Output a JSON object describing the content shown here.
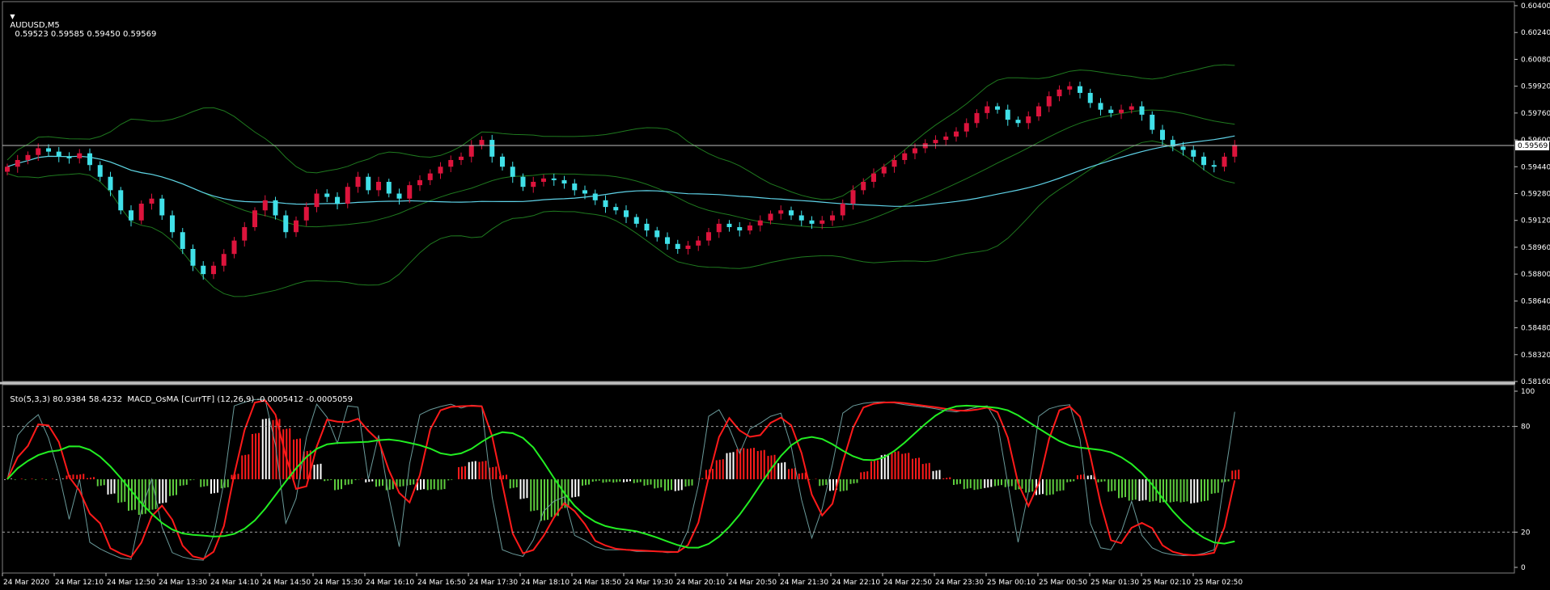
{
  "header": {
    "symbol": "AUDUSD,M5",
    "ohlc": "0.59523 0.59585 0.59450 0.59569"
  },
  "sub_header": "Sto(5,3,3) 80.9384 58.4232  MACD_OsMA [CurrTF] (12,26,9) -0.0005412 -0.0005059",
  "colors": {
    "background": "#000000",
    "bull_candle": "#dc143c",
    "bear_candle": "#40e0e8",
    "bollinger": "#1f7a1f",
    "ma": "#5fd3e8",
    "stoch_main": "#ff1a1a",
    "stoch_signal": "#22ee22",
    "osma_up": "#ff1a1a",
    "osma_down": "#5dcc3d",
    "osma_neutral": "#ffffff"
  },
  "chart_data": [
    {
      "type": "candlestick",
      "title": "AUDUSD,M5",
      "current_price": "0.59569",
      "y_ticks": [
        "0.60400",
        "0.60240",
        "0.60080",
        "0.59920",
        "0.59760",
        "0.59600",
        "0.59440",
        "0.59280",
        "0.59120",
        "0.58960",
        "0.58800",
        "0.58640",
        "0.58480",
        "0.58320",
        "0.58160"
      ],
      "x_ticks": [
        "24 Mar 2020",
        "24 Mar 12:10",
        "24 Mar 12:50",
        "24 Mar 13:30",
        "24 Mar 14:10",
        "24 Mar 14:50",
        "24 Mar 15:30",
        "24 Mar 16:10",
        "24 Mar 16:50",
        "24 Mar 17:30",
        "24 Mar 18:10",
        "24 Mar 18:50",
        "24 Mar 19:30",
        "24 Mar 20:10",
        "24 Mar 20:50",
        "24 Mar 21:30",
        "24 Mar 22:10",
        "24 Mar 22:50",
        "24 Mar 23:30",
        "25 Mar 00:10",
        "25 Mar 00:50",
        "25 Mar 01:30",
        "25 Mar 02:10",
        "25 Mar 02:50"
      ],
      "close_path": [
        0.5944,
        0.5948,
        0.5951,
        0.5955,
        0.5953,
        0.595,
        0.5949,
        0.5952,
        0.5945,
        0.5938,
        0.593,
        0.5918,
        0.5912,
        0.5922,
        0.5925,
        0.5915,
        0.5905,
        0.5895,
        0.5885,
        0.588,
        0.5885,
        0.5892,
        0.59,
        0.5908,
        0.5918,
        0.5924,
        0.5915,
        0.5905,
        0.5912,
        0.592,
        0.5928,
        0.5926,
        0.5922,
        0.5932,
        0.5938,
        0.593,
        0.5935,
        0.5928,
        0.5925,
        0.5933,
        0.5936,
        0.594,
        0.5944,
        0.5948,
        0.595,
        0.5957,
        0.596,
        0.595,
        0.5944,
        0.5938,
        0.5932,
        0.5935,
        0.5937,
        0.5936,
        0.5934,
        0.593,
        0.5928,
        0.5924,
        0.592,
        0.5918,
        0.5914,
        0.591,
        0.5906,
        0.5902,
        0.5898,
        0.5895,
        0.5897,
        0.59,
        0.5905,
        0.591,
        0.5908,
        0.5906,
        0.5909,
        0.5912,
        0.5916,
        0.5918,
        0.5915,
        0.5912,
        0.591,
        0.5912,
        0.5915,
        0.5922,
        0.593,
        0.5935,
        0.594,
        0.5944,
        0.5948,
        0.5952,
        0.5955,
        0.5958,
        0.596,
        0.5962,
        0.5965,
        0.597,
        0.5976,
        0.598,
        0.5978,
        0.5972,
        0.597,
        0.5974,
        0.598,
        0.5986,
        0.599,
        0.5992,
        0.5988,
        0.5982,
        0.5978,
        0.5976,
        0.5978,
        0.598,
        0.5975,
        0.5966,
        0.596,
        0.5956,
        0.5954,
        0.595,
        0.5945,
        0.5944,
        0.595,
        0.5957
      ]
    },
    {
      "type": "line",
      "title": "Sto(5,3,3)",
      "y_ticks": [
        "100",
        "80",
        "20",
        "0"
      ],
      "main_value": 80.9384,
      "signal_value": 58.4232,
      "levels": [
        80,
        20
      ]
    },
    {
      "type": "bar",
      "title": "MACD_OsMA [CurrTF] (12,26,9)",
      "values_text": "-0.0005412 -0.0005059"
    }
  ]
}
